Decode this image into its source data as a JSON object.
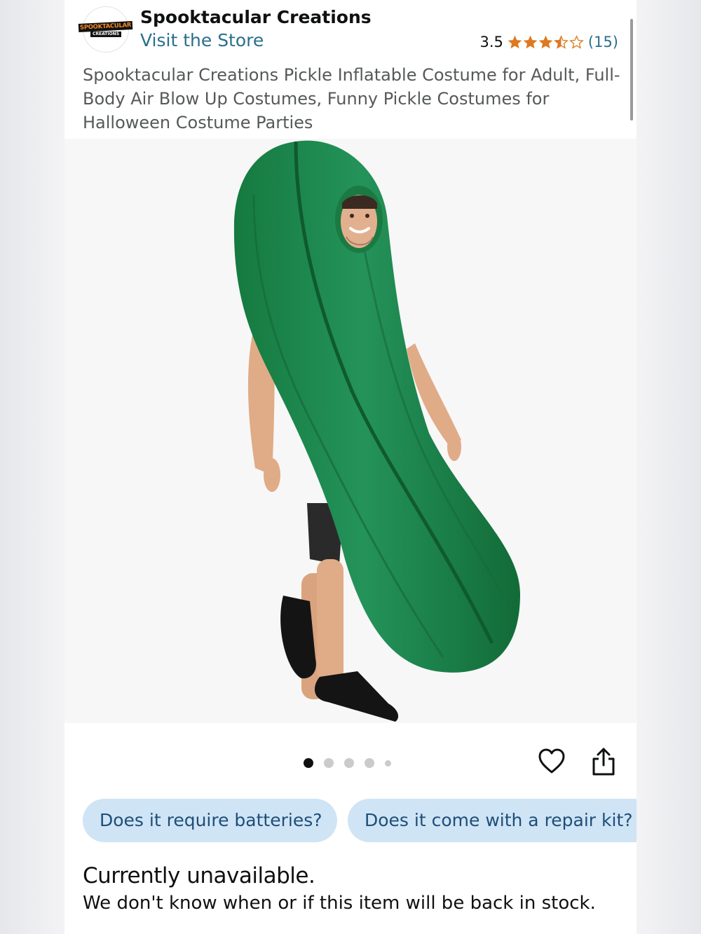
{
  "store": {
    "logo_text_line1": "SPOOKTACULAR",
    "logo_text_line2": "CREATIONS",
    "name": "Spooktacular Creations",
    "visit_link": "Visit the Store"
  },
  "rating": {
    "value": "3.5",
    "stars_filled": 3.5,
    "stars_total": 5,
    "count": "(15)",
    "star_color": "#de7921"
  },
  "product": {
    "title": "Spooktacular Creations Pickle Inflatable Costume for Adult, Full-Body Air Blow Up Costumes, Funny Pickle Costumes for Halloween Costume Parties",
    "image_icon": "product-photo"
  },
  "carousel": {
    "total_dots": 5,
    "active_index": 0
  },
  "actions": {
    "wishlist_icon": "heart-icon",
    "share_icon": "share-icon"
  },
  "questions": [
    "Does it require batteries?",
    "Does it come with a repair kit?"
  ],
  "availability": {
    "status": "Currently unavailable.",
    "message": "We don't know when or if this item will be back in stock."
  },
  "colors": {
    "link": "#2a6f8d",
    "chip_bg": "#cfe4f5",
    "chip_text": "#1f4e79",
    "costume_green": "#1f8a4c"
  }
}
